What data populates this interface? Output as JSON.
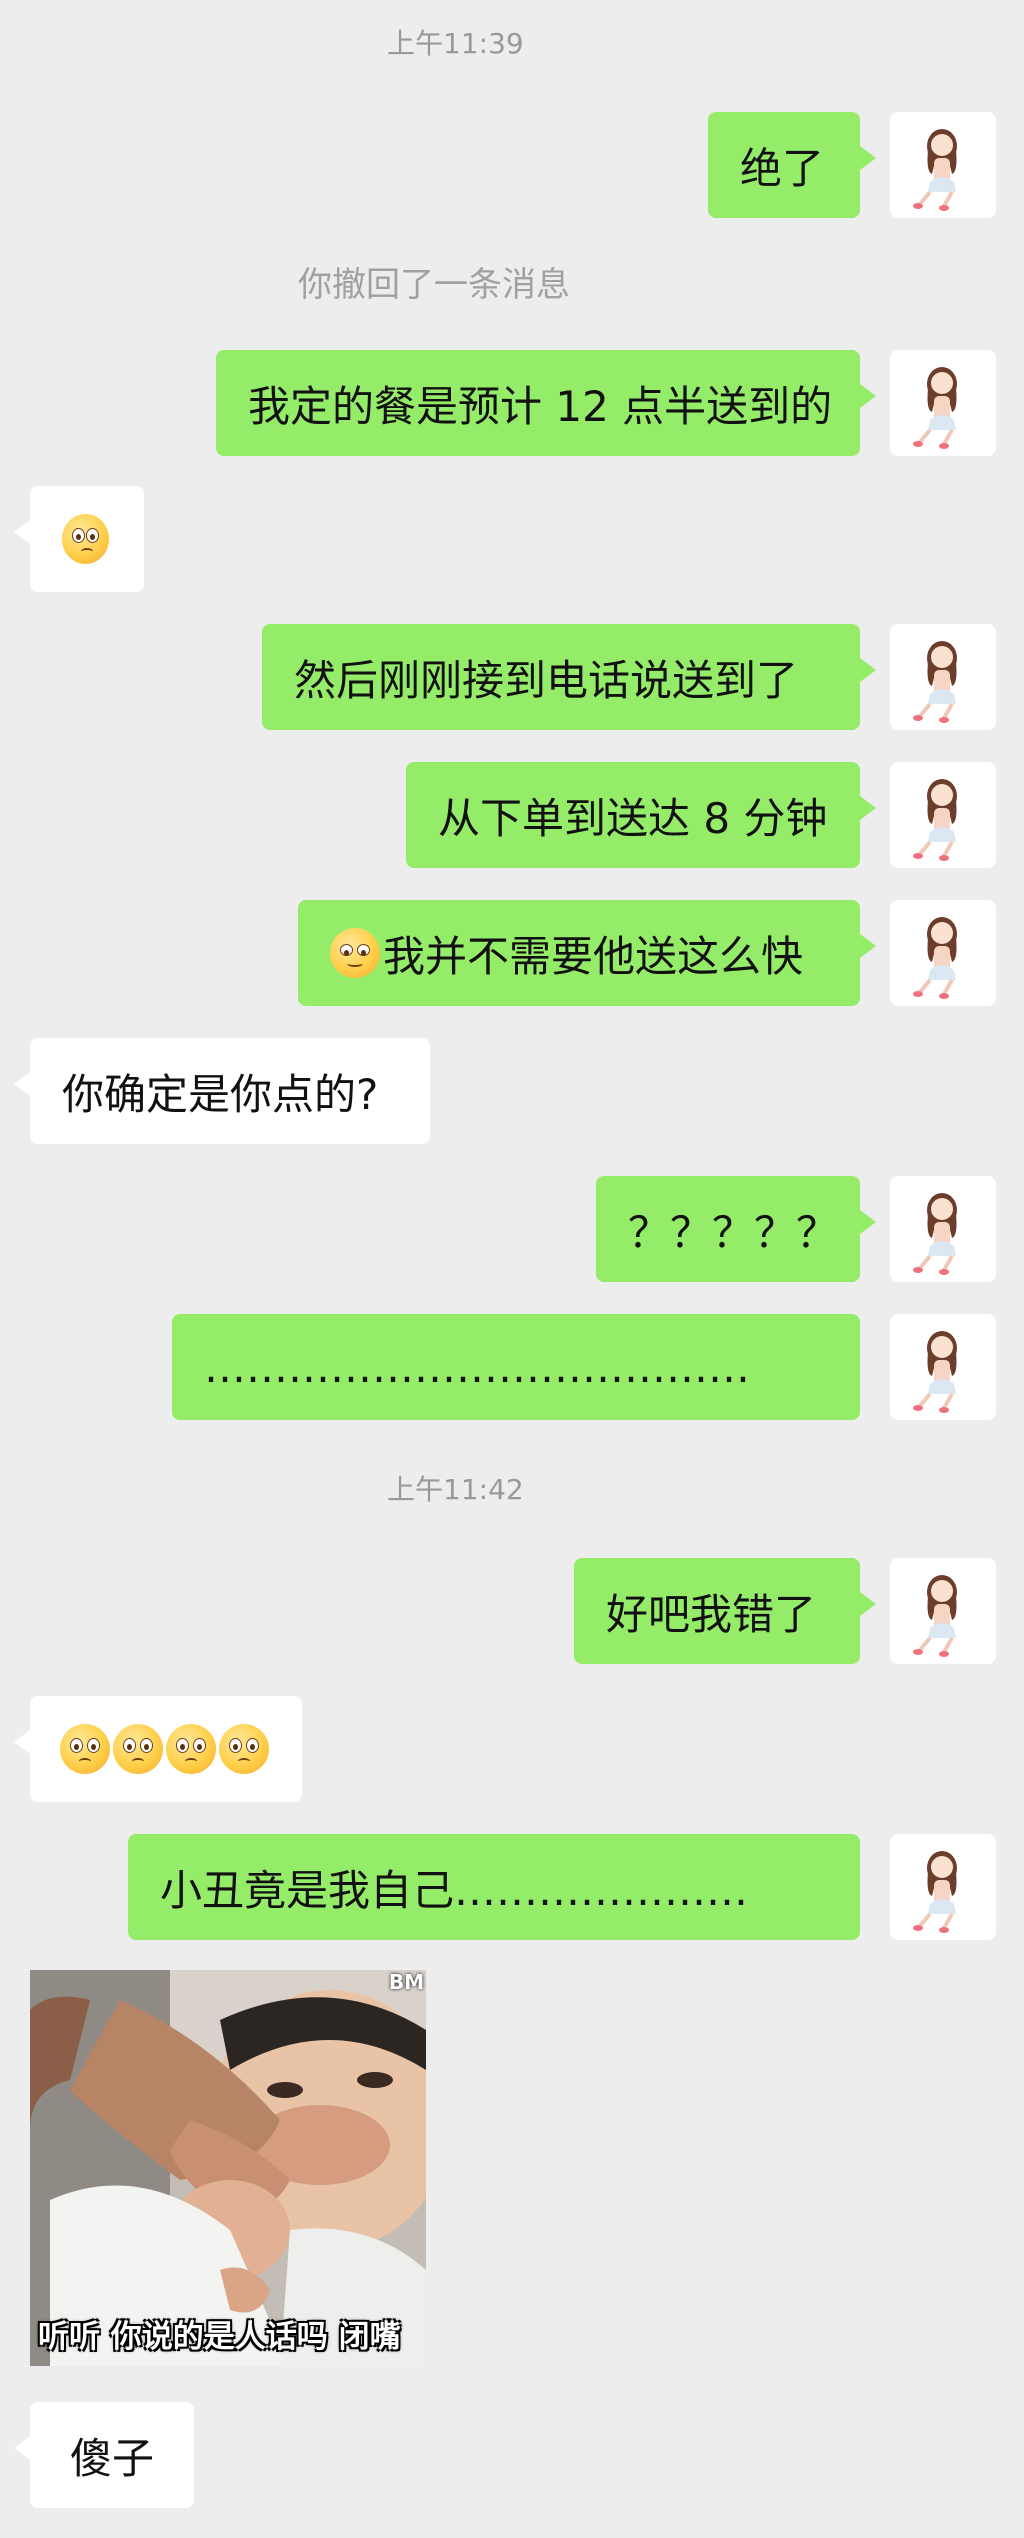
{
  "timestamps": [
    "上午11:39",
    "上午11:42"
  ],
  "system_notice": "你撤回了一条消息",
  "messages": [
    {
      "side": "out",
      "text": "绝了"
    },
    {
      "side": "out",
      "text": "我定的餐是预计 12 点半送到的"
    },
    {
      "side": "in",
      "emoji": "flushed-face"
    },
    {
      "side": "out",
      "text": "然后刚刚接到电话说送到了"
    },
    {
      "side": "out",
      "text": "从下单到送达 8 分钟"
    },
    {
      "side": "out",
      "emoji": "smiling-face",
      "text": "我并不需要他送这么快"
    },
    {
      "side": "in",
      "text": "你确定是你点的?"
    },
    {
      "side": "out",
      "text": "？？？？？"
    },
    {
      "side": "out",
      "text": "…………………………………"
    },
    {
      "side": "out",
      "text": "好吧我错了"
    },
    {
      "side": "in",
      "emoji": "flushed-face x4"
    },
    {
      "side": "out",
      "text": "小丑竟是我自己…………………"
    },
    {
      "side": "in",
      "image": "meme-sticker",
      "caption": "听听 你说的是人话吗  闭嘴",
      "watermark": "BM"
    },
    {
      "side": "in",
      "text": "傻子"
    }
  ],
  "avatar_icon": "cartoon-girl-avatar-icon",
  "colors": {
    "background": "#ededed",
    "outgoing_bubble": "#95ec69",
    "incoming_bubble": "#ffffff",
    "timestamp_text": "#999999"
  }
}
